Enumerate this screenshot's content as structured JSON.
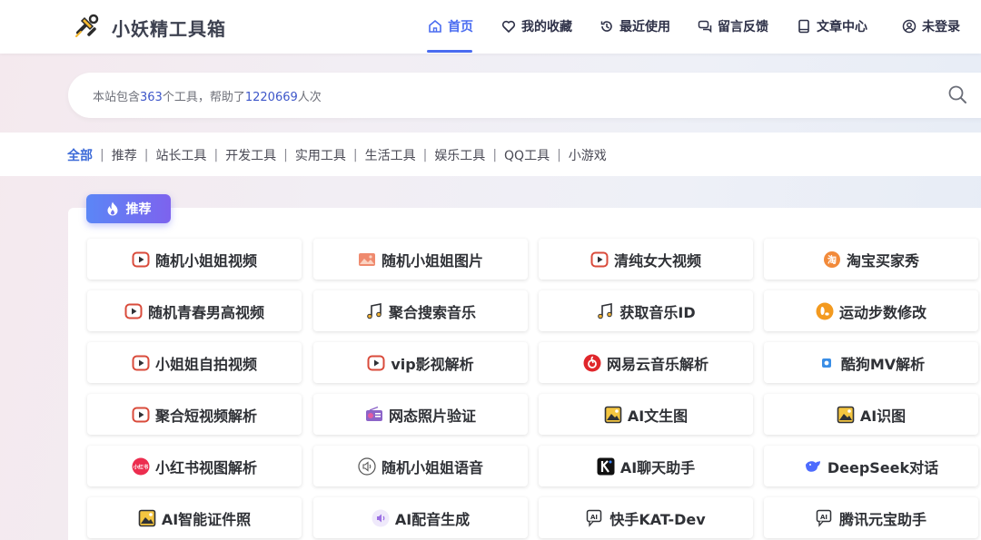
{
  "app": {
    "title": "小妖精工具箱"
  },
  "nav": [
    {
      "label": "首页",
      "icon": "home-icon",
      "active": true
    },
    {
      "label": "我的收藏",
      "icon": "heart-icon"
    },
    {
      "label": "最近使用",
      "icon": "history-icon"
    },
    {
      "label": "留言反馈",
      "icon": "chat-icon"
    },
    {
      "label": "文章中心",
      "icon": "book-icon"
    },
    {
      "label": "未登录",
      "icon": "user-icon"
    }
  ],
  "search": {
    "prefix": "本站包含",
    "tool_count": "363",
    "middle": "个工具，帮助了",
    "help_count": "1220669",
    "suffix": "人次"
  },
  "categories": [
    "全部",
    "推荐",
    "站长工具",
    "开发工具",
    "实用工具",
    "生活工具",
    "娱乐工具",
    "QQ工具",
    "小游戏"
  ],
  "section": {
    "label": "推荐",
    "icon": "flame-icon"
  },
  "tools": [
    {
      "label": "随机小姐姐视频",
      "icon": "video-play-icon"
    },
    {
      "label": "随机小姐姐图片",
      "icon": "image-icon"
    },
    {
      "label": "清纯女大视频",
      "icon": "video-play-icon"
    },
    {
      "label": "淘宝买家秀",
      "icon": "taobao-icon"
    },
    {
      "label": "随机青春男高视频",
      "icon": "video-play-icon"
    },
    {
      "label": "聚合搜索音乐",
      "icon": "music-note-icon"
    },
    {
      "label": "获取音乐ID",
      "icon": "music-note-icon"
    },
    {
      "label": "运动步数修改",
      "icon": "steps-icon"
    },
    {
      "label": "小姐姐自拍视频",
      "icon": "video-play-icon"
    },
    {
      "label": "vip影视解析",
      "icon": "video-play-icon"
    },
    {
      "label": "网易云音乐解析",
      "icon": "netease-music-icon"
    },
    {
      "label": "酷狗MV解析",
      "icon": "kugou-icon"
    },
    {
      "label": "聚合短视频解析",
      "icon": "video-play-icon"
    },
    {
      "label": "网态照片验证",
      "icon": "radio-icon"
    },
    {
      "label": "AI文生图",
      "icon": "picture-icon"
    },
    {
      "label": "AI识图",
      "icon": "picture-icon"
    },
    {
      "label": "小红书视图解析",
      "icon": "xiaohongshu-icon"
    },
    {
      "label": "随机小姐姐语音",
      "icon": "speaker-icon"
    },
    {
      "label": "AI聊天助手",
      "icon": "kimi-icon"
    },
    {
      "label": "DeepSeek对话",
      "icon": "deepseek-icon"
    },
    {
      "label": "AI智能证件照",
      "icon": "picture-icon"
    },
    {
      "label": "AI配音生成",
      "icon": "voice-icon"
    },
    {
      "label": "快手KAT-Dev",
      "icon": "ai-chat-icon"
    },
    {
      "label": "腾讯元宝助手",
      "icon": "ai-chat-icon"
    }
  ],
  "colors": {
    "accent": "#4a6cf0",
    "video": "#d94b3b",
    "badge_from": "#5b86f6",
    "badge_to": "#7d63ee"
  }
}
